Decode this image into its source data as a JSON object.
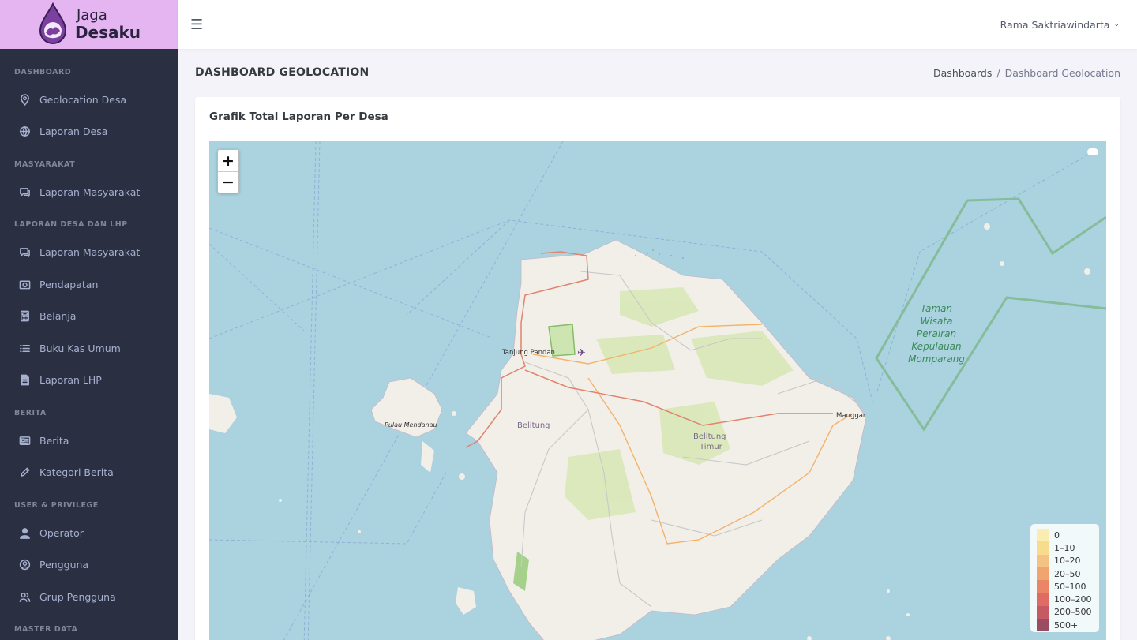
{
  "brand": {
    "line1": "Jaga",
    "line2": "Desaku"
  },
  "sidebar": {
    "sections": [
      {
        "title": "DASHBOARD",
        "items": [
          {
            "label": "Geolocation Desa",
            "icon": "location-pin-icon"
          },
          {
            "label": "Laporan Desa",
            "icon": "globe-icon"
          }
        ]
      },
      {
        "title": "MASYARAKAT",
        "items": [
          {
            "label": "Laporan Masyarakat",
            "icon": "chat-icon"
          }
        ]
      },
      {
        "title": "LAPORAN DESA DAN LHP",
        "items": [
          {
            "label": "Laporan Masyarakat",
            "icon": "chat-icon"
          },
          {
            "label": "Pendapatan",
            "icon": "camera-icon"
          },
          {
            "label": "Belanja",
            "icon": "calculator-icon"
          },
          {
            "label": "Buku Kas Umum",
            "icon": "list-icon"
          },
          {
            "label": "Laporan LHP",
            "icon": "file-icon"
          }
        ]
      },
      {
        "title": "BERITA",
        "items": [
          {
            "label": "Berita",
            "icon": "news-icon"
          },
          {
            "label": "Kategori Berita",
            "icon": "edit-icon"
          }
        ]
      },
      {
        "title": "USER & PRIVILEGE",
        "items": [
          {
            "label": "Operator",
            "icon": "user-icon"
          },
          {
            "label": "Pengguna",
            "icon": "user-circle-icon"
          },
          {
            "label": "Grup Pengguna",
            "icon": "users-icon"
          }
        ]
      },
      {
        "title": "MASTER DATA",
        "items": []
      }
    ]
  },
  "topbar": {
    "user_name": "Rama Saktriawindarta",
    "menu_icon": "hamburger-icon"
  },
  "page": {
    "title": "DASHBOARD GEOLOCATION",
    "breadcrumb": [
      "Dashboards",
      "Dashboard Geolocation"
    ]
  },
  "card": {
    "title": "Grafik Total Laporan Per Desa"
  },
  "map": {
    "zoom_in": "+",
    "zoom_out": "−",
    "labels": {
      "tanjung_pandan": "Tanjung Pandan",
      "manggar": "Manggar",
      "belitung": "Belitung",
      "belitung_timur_1": "Belitung",
      "belitung_timur_2": "Timur",
      "pulau_mendanau": "Pulau Mendanau",
      "taman_1": "Taman",
      "taman_2": "Wisata",
      "taman_3": "Perairan",
      "taman_4": "Kepulauan",
      "taman_5": "Momparang"
    },
    "legend": [
      {
        "label": "0",
        "color": "#f9edb0"
      },
      {
        "label": "1–10",
        "color": "#f7dc8e"
      },
      {
        "label": "10–20",
        "color": "#f4c283"
      },
      {
        "label": "20–50",
        "color": "#f0a571"
      },
      {
        "label": "50–100",
        "color": "#ea8565"
      },
      {
        "label": "100–200",
        "color": "#df6b63"
      },
      {
        "label": "200–500",
        "color": "#c55a65"
      },
      {
        "label": "500+",
        "color": "#9a4c62"
      }
    ]
  }
}
